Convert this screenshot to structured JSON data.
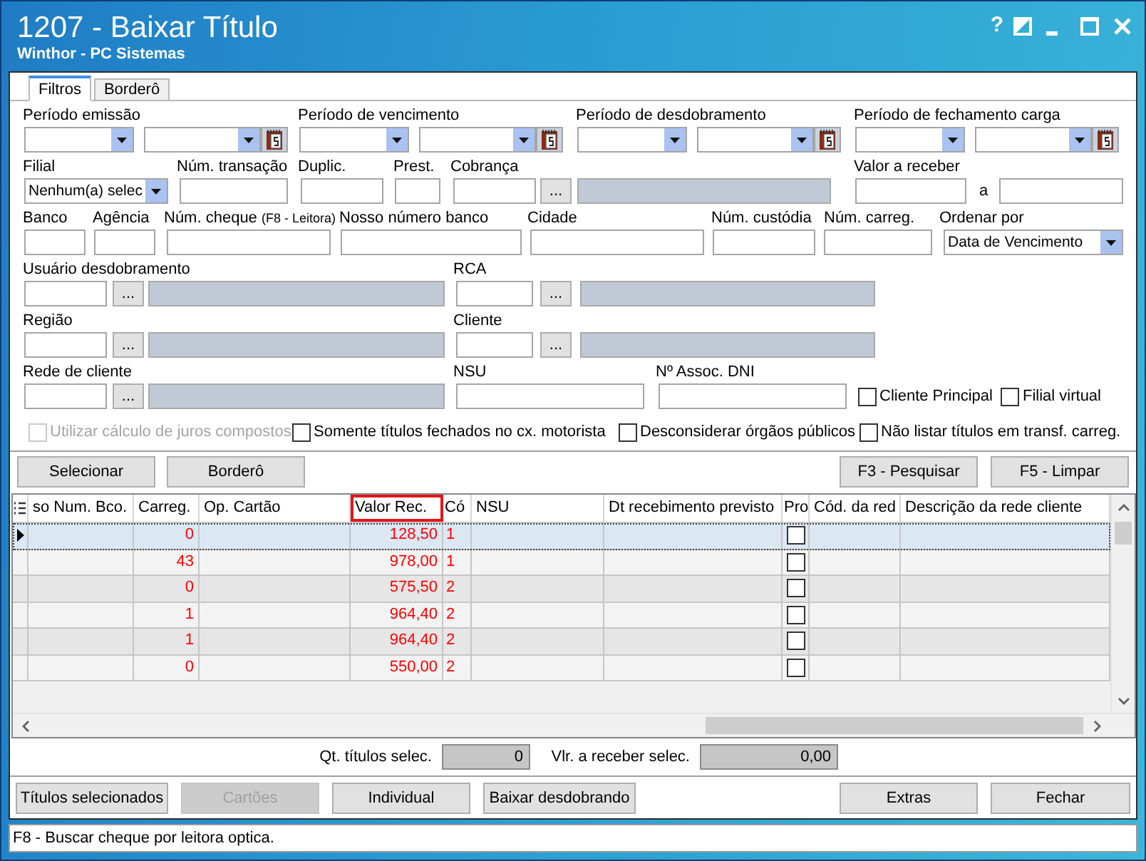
{
  "window": {
    "title": "1207 - Baixar Título",
    "subtitle": "Winthor - PC Sistemas",
    "help_button": "?"
  },
  "tabs": [
    {
      "label": "Filtros",
      "selected": true
    },
    {
      "label": "Borderô",
      "selected": false
    }
  ],
  "filters": {
    "periods": [
      {
        "label": "Período emissão"
      },
      {
        "label": "Período de vencimento"
      },
      {
        "label": "Período de desdobramento"
      },
      {
        "label": "Período de fechamento carga"
      }
    ],
    "filial": {
      "label": "Filial",
      "value": "Nenhum(a) selec"
    },
    "num_transacao": {
      "label": "Núm. transação"
    },
    "duplic": {
      "label": "Duplic."
    },
    "prest": {
      "label": "Prest."
    },
    "cobranca": {
      "label": "Cobrança",
      "button": "..."
    },
    "valor_a_receber": {
      "label": "Valor a receber",
      "separator": "a"
    },
    "banco": {
      "label": "Banco"
    },
    "agencia": {
      "label": "Agência"
    },
    "num_cheque": {
      "label": "Núm. cheque",
      "hint": "(F8 - Leitora)"
    },
    "nosso_numero_banco": {
      "label": "Nosso número banco"
    },
    "cidade": {
      "label": "Cidade"
    },
    "num_custodia": {
      "label": "Núm. custódia"
    },
    "num_carreg": {
      "label": "Núm. carreg."
    },
    "ordenar_por": {
      "label": "Ordenar por",
      "value": "Data de Vencimento"
    },
    "lookups": [
      [
        {
          "label": "Usuário desdobramento",
          "button": "..."
        },
        {
          "label": "RCA",
          "button": "..."
        }
      ],
      [
        {
          "label": "Região",
          "button": "..."
        },
        {
          "label": "Cliente",
          "button": "..."
        }
      ]
    ],
    "rede_de_cliente": {
      "label": "Rede de cliente",
      "button": "..."
    },
    "nsu": {
      "label": "NSU"
    },
    "assoc_dni": {
      "label": "Nº Assoc. DNI"
    },
    "flags": [
      {
        "label": "Cliente Principal",
        "checked": false
      },
      {
        "label": "Filial virtual",
        "checked": false
      }
    ],
    "options": [
      {
        "label": "Utilizar cálculo de juros compostos",
        "checked": false,
        "disabled": true
      },
      {
        "label": "Somente títulos fechados no cx. motorista",
        "checked": false,
        "disabled": false
      },
      {
        "label": "Desconsiderar órgãos públicos",
        "checked": false,
        "disabled": false
      },
      {
        "label": "Não listar títulos em transf. carreg.",
        "checked": false,
        "disabled": false
      }
    ]
  },
  "actions_left": [
    {
      "label": "Selecionar"
    },
    {
      "label": "Borderô"
    }
  ],
  "actions_right": [
    {
      "label": "F3 - Pesquisar"
    },
    {
      "label": "F5 - Limpar"
    }
  ],
  "table": {
    "columns": [
      {
        "label": "so Num. Bco.",
        "highlighted": false
      },
      {
        "label": "Carreg.",
        "highlighted": false
      },
      {
        "label": "Op. Cartão",
        "highlighted": false
      },
      {
        "label": "Valor Rec.",
        "highlighted": true
      },
      {
        "label": "Có",
        "highlighted": false
      },
      {
        "label": "NSU",
        "highlighted": false
      },
      {
        "label": "Dt recebimento previsto",
        "highlighted": false
      },
      {
        "label": "Pro",
        "highlighted": false
      },
      {
        "label": "Cód. da red",
        "highlighted": false
      },
      {
        "label": "Descrição da rede cliente",
        "highlighted": false
      }
    ],
    "rows": [
      {
        "selected": true,
        "carreg": "0",
        "valor_rec": "128,50",
        "cod": "1",
        "pro_checked": false
      },
      {
        "selected": false,
        "carreg": "43",
        "valor_rec": "978,00",
        "cod": "1",
        "pro_checked": false
      },
      {
        "selected": false,
        "carreg": "0",
        "valor_rec": "575,50",
        "cod": "2",
        "pro_checked": false
      },
      {
        "selected": false,
        "carreg": "1",
        "valor_rec": "964,40",
        "cod": "2",
        "pro_checked": false
      },
      {
        "selected": false,
        "carreg": "1",
        "valor_rec": "964,40",
        "cod": "2",
        "pro_checked": false
      },
      {
        "selected": false,
        "carreg": "0",
        "valor_rec": "550,00",
        "cod": "2",
        "pro_checked": false
      }
    ]
  },
  "totals": [
    {
      "label": "Qt. títulos selec.",
      "value": "0"
    },
    {
      "label": "Vlr. a receber selec.",
      "value": "0,00"
    }
  ],
  "bottom_actions_left": [
    {
      "label": "Títulos selecionados",
      "disabled": false
    },
    {
      "label": "Cartões",
      "disabled": true
    },
    {
      "label": "Individual",
      "disabled": false
    },
    {
      "label": "Baixar desdobrando",
      "disabled": false
    }
  ],
  "bottom_actions_right": [
    {
      "label": "Extras",
      "disabled": false
    },
    {
      "label": "Fechar",
      "disabled": false
    }
  ],
  "status_bar": "F8 - Buscar cheque por leitora optica."
}
